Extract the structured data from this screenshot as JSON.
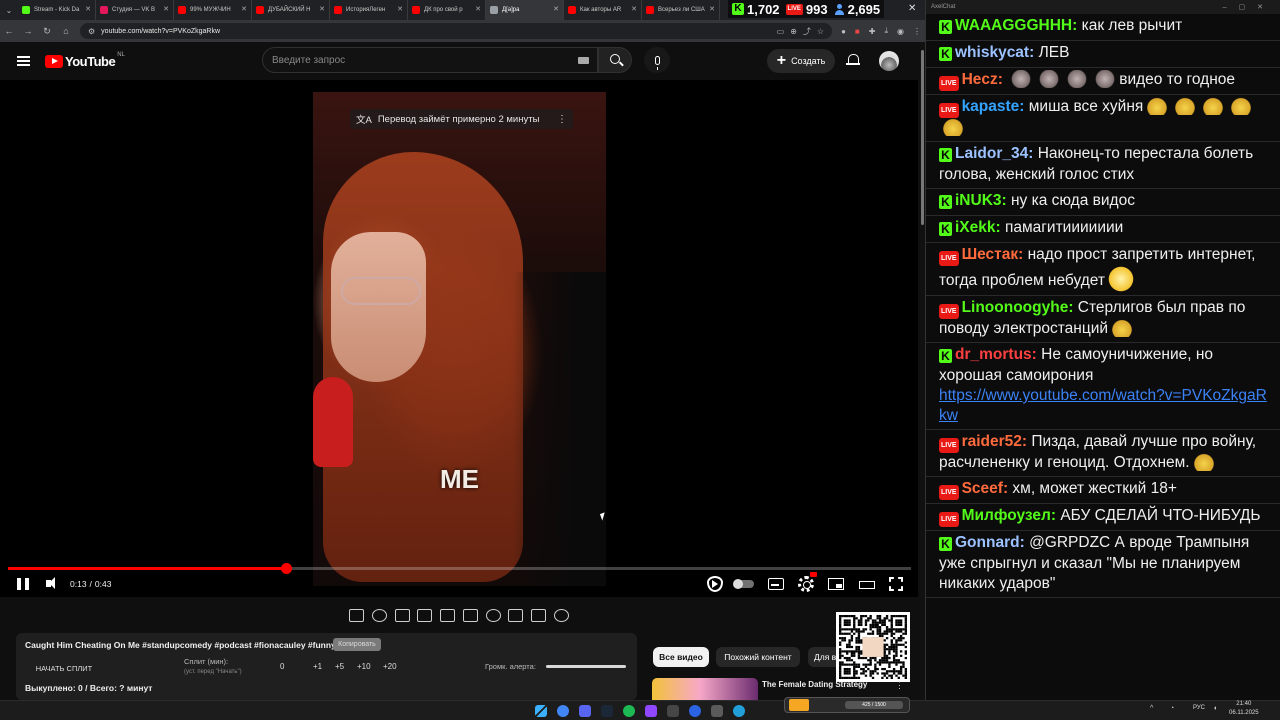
{
  "browser": {
    "tabs": [
      {
        "label": "Stream - Kick Da",
        "favicon_color": "#53fc18",
        "active": false
      },
      {
        "label": "Студия — VK B",
        "favicon_color": "#e5175b",
        "active": false
      },
      {
        "label": "99% МУЖЧИН",
        "favicon_color": "#ff0000",
        "active": false
      },
      {
        "label": "ДУБАЙСКИЙ Н",
        "favicon_color": "#ff0000",
        "active": false
      },
      {
        "label": "ИсторияЛеген",
        "favicon_color": "#ff0000",
        "active": false
      },
      {
        "label": "ДК про свой р",
        "favicon_color": "#ff0000",
        "active": false
      },
      {
        "label": "Д[a]ра",
        "favicon_color": "#9aa0a6",
        "active": true
      },
      {
        "label": "Как авторы AR",
        "favicon_color": "#ff0000",
        "active": false
      },
      {
        "label": "Всерьез ли США",
        "favicon_color": "#ff0000",
        "active": false
      }
    ],
    "url": "youtube.com/watch?v=PVKoZkgaRkw"
  },
  "stats": {
    "kick_viewers": "1,702",
    "vk_viewers": "993",
    "total_viewers": "2,695"
  },
  "youtube": {
    "logo_text": "YouTube",
    "region": "NL",
    "search_placeholder": "Введите запрос",
    "create_label": "Создать"
  },
  "player": {
    "translate_notice": "Перевод займёт примерно 2 минуты",
    "caption": "ME",
    "time_current": "0:13",
    "time_separator": "/",
    "time_total": "0:43",
    "progress_fraction": 0.308
  },
  "video_info": {
    "title": "Caught Him Cheating On Me #standupcomedy #podcast #fionacauley #funny",
    "copy_label": "Копировать",
    "split_button": "НАЧАТЬ СПЛИТ",
    "split_label": "Сплит (мин):",
    "split_hint": "(уст. перед \"Начать\")",
    "split_value": "0",
    "increments": [
      "+1",
      "+5",
      "+10",
      "+20"
    ],
    "alert_volume_label": "Громк. алерта:",
    "status": "Выкуплено: 0 / Всего: ? минут"
  },
  "recommendations": {
    "chips": [
      "Все видео",
      "Похожий контент",
      "Для в"
    ],
    "first_title": "The Female Dating Strategy"
  },
  "chat": {
    "window_title": "AxelChat",
    "platform_colors": {
      "kick": "#53fc18",
      "vk": "#e91916"
    },
    "messages": [
      {
        "platform": "kick",
        "user": "WAAAGGGHHH",
        "color": "#53fc18",
        "text": "как лев рычит",
        "emotes": ""
      },
      {
        "platform": "kick",
        "user": "whiskycat",
        "color": "#9cc2ff",
        "text": "ЛЕВ",
        "emotes": ""
      },
      {
        "platform": "vk",
        "user": "Hecz",
        "color": "#ff6b3d",
        "text": "видео то годное",
        "emotes": "wolf4"
      },
      {
        "platform": "vk",
        "user": "kapaste",
        "color": "#33a3ff",
        "text": "миша все хуйня",
        "emotes": "tail5"
      },
      {
        "platform": "kick",
        "user": "Laidor_34",
        "color": "#9cc2ff",
        "text": "Наконец-то перестала болеть голова, женский голос стих",
        "emotes": ""
      },
      {
        "platform": "kick",
        "user": "iNUK3",
        "color": "#53fc18",
        "text": "ну ка сюда видос",
        "emotes": ""
      },
      {
        "platform": "kick",
        "user": "iXekk",
        "color": "#53fc18",
        "text": "памагитиииииии",
        "emotes": ""
      },
      {
        "platform": "vk",
        "user": "Шестак",
        "color": "#ff6b3d",
        "text": "надо прост запретить интернет, тогда проблем небудет",
        "emotes": "grin1"
      },
      {
        "platform": "vk",
        "user": "Linoonoogyhe",
        "color": "#53fc18",
        "text": "Стерлигов был прав по поводу электростанций",
        "emotes": "tail1"
      },
      {
        "platform": "kick",
        "user": "dr_mortus",
        "color": "#ff4040",
        "text": "Не самоуничижение, но хорошая самоирония",
        "link": "https://www.youtube.com/watch?v=PVKoZkgaRkw",
        "emotes": ""
      },
      {
        "platform": "vk",
        "user": "raider52",
        "color": "#ff6b3d",
        "text": "Пизда, давай лучше про войну, расчлененку и геноцид. Отдохнем.",
        "emotes": "tail1"
      },
      {
        "platform": "vk",
        "user": "Sceef",
        "color": "#ff6b3d",
        "text": "хм, может жесткий 18+",
        "emotes": ""
      },
      {
        "platform": "vk",
        "user": "Милфоузел",
        "color": "#53fc18",
        "text": "АБУ СДЕЛАЙ ЧТО-НИБУДЬ",
        "emotes": ""
      },
      {
        "platform": "kick",
        "user": "Gonnard",
        "color": "#9cc2ff",
        "text": "@GRPDZC А вроде Трампыня уже спрыгнул и сказал \"Мы не планируем никаких ударов\"",
        "emotes": ""
      }
    ]
  },
  "taskbar": {
    "overlay_text": "425 / 1500",
    "lang": "РУС",
    "time": "21:40",
    "date": "06.11.2025"
  }
}
